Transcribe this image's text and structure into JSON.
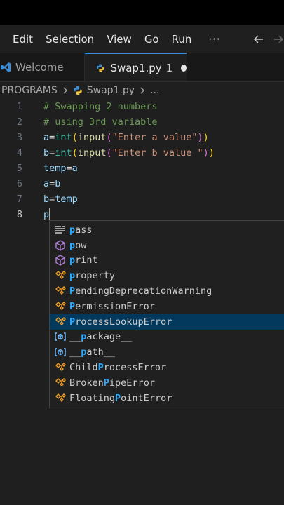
{
  "menu": {
    "items": [
      "Edit",
      "Selection",
      "View",
      "Go",
      "Run"
    ],
    "more": "···"
  },
  "tabs": {
    "welcome": "Welcome",
    "active": "Swap1.py",
    "active_suffix": "1"
  },
  "breadcrumb": {
    "folder": "PROGRAMS",
    "file": "Swap1.py",
    "tail": "..."
  },
  "code": {
    "line_numbers": [
      "1",
      "2",
      "3",
      "4",
      "5",
      "6",
      "7",
      "8"
    ],
    "line1": "# Swapping 2 numbers",
    "line2": "# using 3rd variable",
    "line3": {
      "var": "a",
      "eq": "=",
      "cast": "int",
      "fn": "input",
      "str": "\"Enter a value\"",
      "close": "))"
    },
    "line4": {
      "var": "b",
      "eq": "=",
      "cast": "int",
      "fn": "input",
      "str": "\"Enter b value \"",
      "close": "))"
    },
    "line5": {
      "lhs": "temp",
      "eq": "=",
      "rhs": "a"
    },
    "line6": {
      "lhs": "a",
      "eq": "=",
      "rhs": "b"
    },
    "line7": {
      "lhs": "b",
      "eq": "=",
      "rhs": "temp"
    },
    "line8": "p"
  },
  "suggestions": [
    {
      "kind": "keyword-icon",
      "hl": "p",
      "rest": "ass"
    },
    {
      "kind": "method-icon",
      "hl": "p",
      "rest": "ow"
    },
    {
      "kind": "method-icon",
      "hl": "p",
      "rest": "rint"
    },
    {
      "kind": "class-icon",
      "hl": "p",
      "rest": "roperty"
    },
    {
      "kind": "class-icon",
      "hl": "P",
      "rest": "endingDeprecationWarning"
    },
    {
      "kind": "class-icon",
      "hl": "P",
      "rest": "ermissionError"
    },
    {
      "kind": "class-icon",
      "hl": "P",
      "rest": "rocessLookupError",
      "selected": true
    },
    {
      "kind": "variable-icon",
      "pre": "__",
      "hl": "p",
      "rest": "ackage__"
    },
    {
      "kind": "variable-icon",
      "pre": "__",
      "hl": "p",
      "rest": "ath__"
    },
    {
      "kind": "class-icon",
      "pre": "Child",
      "hl": "P",
      "rest": "rocessError"
    },
    {
      "kind": "class-icon",
      "pre": "Broken",
      "hl": "P",
      "rest": "ipeError"
    },
    {
      "kind": "class-icon",
      "pre": "Floating",
      "hl": "P",
      "rest": "ointError"
    }
  ],
  "colors": {
    "accent": "#3c8cdc",
    "highlight": "#2aaaff",
    "selected_bg": "#04395e",
    "python_yellow": "#f0c43b",
    "python_blue": "#3b8fd4"
  }
}
